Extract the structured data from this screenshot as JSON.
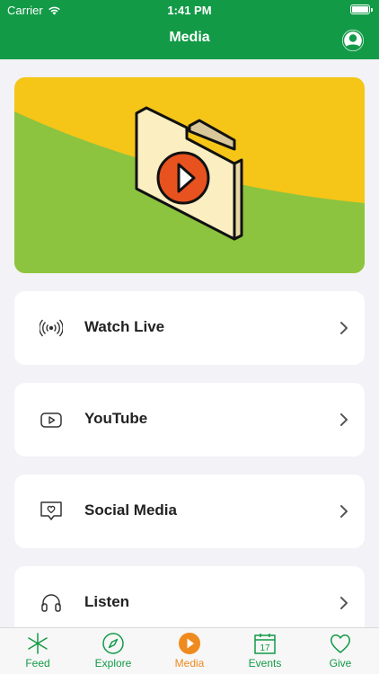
{
  "status_bar": {
    "carrier": "Carrier",
    "time": "1:41 PM"
  },
  "header": {
    "title": "Media"
  },
  "hero": {
    "colors": {
      "top": "#f5c518",
      "bottom": "#8cc43f",
      "play": "#e8521f",
      "folder": "#fbeec0"
    }
  },
  "menu": {
    "items": [
      {
        "label": "Watch Live",
        "icon": "broadcast-icon"
      },
      {
        "label": "YouTube",
        "icon": "youtube-icon"
      },
      {
        "label": "Social Media",
        "icon": "social-heart-icon"
      },
      {
        "label": "Listen",
        "icon": "headphones-icon"
      }
    ]
  },
  "tabbar": {
    "tabs": [
      {
        "label": "Feed",
        "icon": "feed-icon",
        "active": false
      },
      {
        "label": "Explore",
        "icon": "compass-icon",
        "active": false
      },
      {
        "label": "Media",
        "icon": "play-icon",
        "active": true
      },
      {
        "label": "Events",
        "icon": "calendar-icon",
        "active": false,
        "calendar_day": "17"
      },
      {
        "label": "Give",
        "icon": "heart-icon",
        "active": false
      }
    ]
  },
  "colors": {
    "brand": "#129a47",
    "accent": "#ef8a1f",
    "background": "#f2f2f7"
  }
}
